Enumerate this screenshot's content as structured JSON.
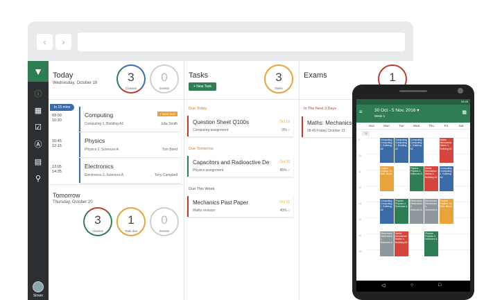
{
  "today": {
    "title": "Today",
    "date": "Wednesday, October 19",
    "classes": {
      "num": "3",
      "label": "Classes"
    },
    "events": {
      "num": "0",
      "label": "Events"
    },
    "in15": "In 15 mins",
    "lessons": [
      {
        "start": "09:00",
        "end": "10:30",
        "name": "Computing",
        "room": "Computing 1, Building A2",
        "teacher": "Julia Smith",
        "badge": "1 TASK DUE"
      },
      {
        "start": "10:45",
        "end": "12:15",
        "name": "Physics",
        "room": "Physics 2, Sciences A",
        "teacher": "Tom Bond",
        "badge": ""
      },
      {
        "start": "13:05",
        "end": "14:35",
        "name": "Electronics",
        "room": "Electronics 3, Sciences A",
        "teacher": "Tony Campbell",
        "badge": ""
      }
    ]
  },
  "tomorrow": {
    "title": "Tomorrow",
    "date": "Thursday, October 20",
    "classes": {
      "num": "3",
      "label": "Classes"
    },
    "tasks": {
      "num": "1",
      "label": "Task due"
    },
    "events": {
      "num": "0",
      "label": "Events"
    }
  },
  "tasks": {
    "title": "Tasks",
    "new_button": "+ New Task",
    "count": {
      "num": "3",
      "label": "Tasks"
    },
    "sections": [
      "Due Today",
      "Due Tomorrow",
      "Due This Week"
    ],
    "items": [
      {
        "name": "Question Sheet Q100s",
        "type": "Computing assignment",
        "date": "Oct 19",
        "pct": "0% ○"
      },
      {
        "name": "Capacitors and Radioactive Decay",
        "type": "Physics assignment",
        "date": "Oct 20",
        "pct": "85% ○"
      },
      {
        "name": "Mechanics Past Paper",
        "type": "Maths revision",
        "date": "Oct 21",
        "pct": "40% ○"
      }
    ]
  },
  "exams": {
    "title": "Exams",
    "count": {
      "num": "1",
      "label": "Exams"
    },
    "section": "In The Next 3 Days",
    "item": {
      "name": "Maths: Mechanics",
      "meta": "08:45 Friday, October 21"
    }
  },
  "sidebar": {
    "user": "Simon"
  },
  "phone": {
    "status": "08:45",
    "range": "30 Oct - 5 Nov, 2016 ▾",
    "week": "Week 1",
    "days": [
      "Sun",
      "Mon",
      "Tue",
      "Wed",
      "Thu",
      "Fri",
      "Sat"
    ],
    "allday": "TE",
    "hours": [
      "9",
      "10",
      "11",
      "12",
      "13",
      "14",
      "15",
      "16"
    ],
    "events": [
      {
        "text": "Computing Computing 1, Building A2",
        "color": "blue",
        "day": 1,
        "slot": 0
      },
      {
        "text": "Computing Computing 1, Building A2",
        "color": "blue",
        "day": 2,
        "slot": 0
      },
      {
        "text": "Computing Computing 1, Building A2",
        "color": "blue",
        "day": 3,
        "slot": 0
      },
      {
        "text": "Maths Mechanics Maths 4, Building A2",
        "color": "red",
        "day": 5,
        "slot": 0
      },
      {
        "text": "English English 7a, Main Block",
        "color": "orange",
        "day": 1,
        "slot": 1
      },
      {
        "text": "Physics Physics 2, Sciences A",
        "color": "green",
        "day": 3,
        "slot": 1
      },
      {
        "text": "Maths Mechanics Maths 4, Building A2",
        "color": "red",
        "day": 4,
        "slot": 1
      },
      {
        "text": "Computing Computing 1, Building A2",
        "color": "blue",
        "day": 5,
        "slot": 1
      },
      {
        "text": "Computing Computing 1, Building A2",
        "color": "blue",
        "day": 1,
        "slot": 2
      },
      {
        "text": "Physics Physics 2, Sciences A",
        "color": "green",
        "day": 2,
        "slot": 2
      },
      {
        "text": "Electronics Electronics 3, Sciences A",
        "color": "grey",
        "day": 3,
        "slot": 2
      },
      {
        "text": "Electronics Electronics 3, Sciences A",
        "color": "grey",
        "day": 4,
        "slot": 2
      },
      {
        "text": "English English 7a, Main Block",
        "color": "orange",
        "day": 5,
        "slot": 2
      },
      {
        "text": "Electronics Electronics 3, Sciences A",
        "color": "grey",
        "day": 1,
        "slot": 3
      },
      {
        "text": "Maths Mechanics Maths 4, Building A2",
        "color": "red",
        "day": 2,
        "slot": 3
      },
      {
        "text": "Physics Physics 2, Sciences A",
        "color": "green",
        "day": 4,
        "slot": 3
      }
    ]
  }
}
